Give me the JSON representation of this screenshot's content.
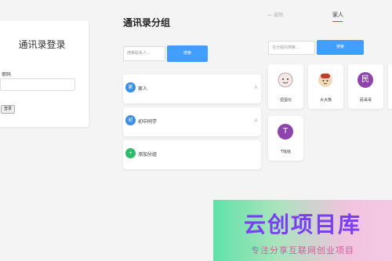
{
  "login": {
    "title": "通讯录登录",
    "password_label": "密码",
    "password_value": "",
    "login_button": "登录"
  },
  "groups": {
    "title": "通讯录分组",
    "search_placeholder": "搜索联系人...",
    "search_button": "搜索",
    "items": [
      {
        "icon": "家",
        "name": "家人",
        "count": "从",
        "color": "#3a8ee6"
      },
      {
        "icon": "初",
        "name": "初中同学",
        "count": "从",
        "color": "#3a8ee6"
      },
      {
        "icon": "+",
        "name": "添加分组",
        "count": "",
        "color": "#2dbb6e"
      }
    ]
  },
  "family": {
    "back": "← 返回",
    "title": "家人",
    "search_placeholder": "在分组内搜索...",
    "search_button": "搜索",
    "members": [
      {
        "name": "扭蛋仪",
        "avatar": "cartoon-avatar"
      },
      {
        "name": "大大熊",
        "avatar": "cartoon-avatar"
      },
      {
        "name": "民哥哥",
        "letter": "民",
        "color": "#8e44ad"
      },
      {
        "name": "T哒哒",
        "letter": "T",
        "color": "#8e44ad"
      }
    ]
  },
  "watermark": {
    "title": "云创项目库",
    "subtitle": "专注分享互联网创业项目"
  }
}
